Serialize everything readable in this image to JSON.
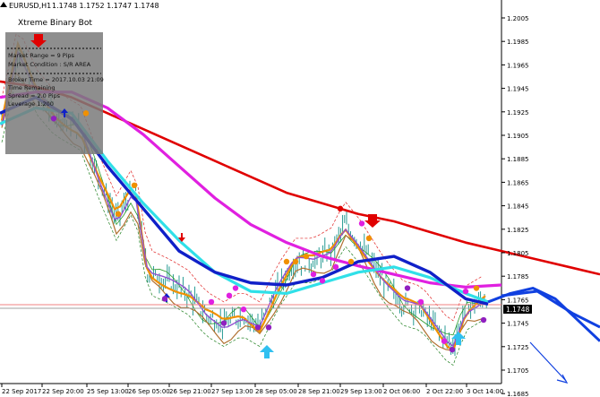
{
  "header": {
    "symbol": "EURUSD,H1",
    "ohlc": "1.1748 1.1752 1.1747 1.1748"
  },
  "info_panel": {
    "title": "Xtreme Binary Bot",
    "lines": [
      "Market Range = 9 Pips",
      "Market Condition : S/R AREA",
      "Broker Time = 2017.10.03 21:09",
      "Time Remaining",
      "Spread = 2.0 Pips",
      "Leverage 1:200"
    ]
  },
  "price_axis": {
    "labels": [
      "1.2005",
      "1.1985",
      "1.1965",
      "1.1945",
      "1.1925",
      "1.1905",
      "1.1885",
      "1.1865",
      "1.1845",
      "1.1825",
      "1.1805",
      "1.1785",
      "1.1765",
      "1.1745",
      "1.1725",
      "1.1705",
      "1.1685"
    ],
    "current_price": "1.1748"
  },
  "time_axis": {
    "labels": [
      "22 Sep 2017",
      "22 Sep 20:00",
      "25 Sep 13:00",
      "26 Sep 05:00",
      "26 Sep 21:00",
      "27 Sep 13:00",
      "28 Sep 05:00",
      "28 Sep 21:00",
      "29 Sep 13:00",
      "2 Oct 06:00",
      "2 Oct 22:00",
      "3 Oct 14:00"
    ]
  },
  "colors": {
    "ma_red": "#e00000",
    "ma_magenta": "#e020e0",
    "ma_cyan": "#30e0e8",
    "ma_blue": "#1020c8",
    "ma_orange": "#f09000",
    "arrow_up": "#30c0f0",
    "arrow_down": "#e00000",
    "projection": "#1040e0",
    "candle": "#109088"
  },
  "chart_data": {
    "type": "line",
    "instrument": "EURUSD",
    "timeframe": "H1",
    "ylim": [
      1.1675,
      1.2025
    ],
    "series": [
      {
        "name": "",
        "color": "#e00000",
        "x": [
          0,
          40,
          80,
          120,
          160,
          200,
          240,
          280,
          320,
          360,
          400,
          440,
          480,
          520,
          560,
          600,
          640,
          670
        ],
        "values": [
          1.196,
          1.1955,
          1.1945,
          1.193,
          1.1915,
          1.19,
          1.1885,
          1.187,
          1.1855,
          1.1845,
          1.1835,
          1.1828,
          1.1818,
          1.1808,
          1.18,
          1.1792,
          1.1784,
          1.1778
        ]
      },
      {
        "name": "",
        "color": "#e020e0",
        "x": [
          0,
          40,
          80,
          120,
          160,
          200,
          240,
          280,
          320,
          360,
          400,
          440,
          480,
          520,
          560
        ],
        "values": [
          1.1945,
          1.195,
          1.195,
          1.1935,
          1.191,
          1.188,
          1.185,
          1.1825,
          1.1808,
          1.1795,
          1.1786,
          1.1778,
          1.177,
          1.1766,
          1.1768
        ]
      },
      {
        "name": "",
        "color": "#30e0e8",
        "x": [
          0,
          40,
          80,
          120,
          160,
          200,
          240,
          280,
          320,
          360,
          400,
          440,
          480,
          520,
          545
        ],
        "values": [
          1.192,
          1.1935,
          1.193,
          1.1885,
          1.1845,
          1.181,
          1.178,
          1.1762,
          1.176,
          1.177,
          1.178,
          1.1785,
          1.1775,
          1.176,
          1.1752
        ]
      },
      {
        "name": "",
        "color": "#1020c8",
        "x": [
          0,
          40,
          80,
          120,
          160,
          200,
          240,
          280,
          320,
          360,
          400,
          440,
          480,
          520,
          545
        ],
        "values": [
          1.193,
          1.1945,
          1.1925,
          1.188,
          1.184,
          1.18,
          1.178,
          1.177,
          1.1768,
          1.1775,
          1.179,
          1.1795,
          1.178,
          1.1755,
          1.175
        ]
      },
      {
        "name": "",
        "color": "#1040e0",
        "x": [
          545,
          570,
          595,
          620,
          645,
          670
        ],
        "values": [
          1.1752,
          1.176,
          1.1765,
          1.1755,
          1.1735,
          1.1715
        ]
      }
    ]
  }
}
